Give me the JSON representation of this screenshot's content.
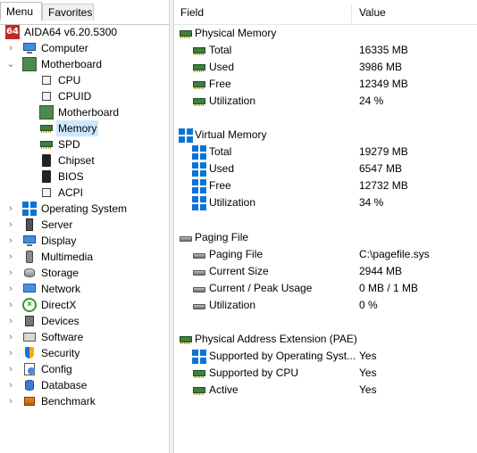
{
  "tabs": [
    {
      "label": "Menu",
      "active": true
    },
    {
      "label": "Favorites",
      "active": false
    }
  ],
  "tree": {
    "root": {
      "label": "AIDA64 v6.20.5300",
      "icon": "aida64-icon"
    },
    "items": [
      {
        "label": "Computer",
        "icon": "computer-icon",
        "expanded": false
      },
      {
        "label": "Motherboard",
        "icon": "motherboard-icon",
        "expanded": true,
        "children": [
          {
            "label": "CPU",
            "icon": "cpu-icon"
          },
          {
            "label": "CPUID",
            "icon": "cpuid-icon"
          },
          {
            "label": "Motherboard",
            "icon": "motherboard-icon"
          },
          {
            "label": "Memory",
            "icon": "memory-icon",
            "selected": true
          },
          {
            "label": "SPD",
            "icon": "spd-icon"
          },
          {
            "label": "Chipset",
            "icon": "chipset-icon"
          },
          {
            "label": "BIOS",
            "icon": "bios-icon"
          },
          {
            "label": "ACPI",
            "icon": "acpi-icon"
          }
        ]
      },
      {
        "label": "Operating System",
        "icon": "windows-icon",
        "expanded": false
      },
      {
        "label": "Server",
        "icon": "server-icon",
        "expanded": false
      },
      {
        "label": "Display",
        "icon": "display-icon",
        "expanded": false
      },
      {
        "label": "Multimedia",
        "icon": "multimedia-icon",
        "expanded": false
      },
      {
        "label": "Storage",
        "icon": "storage-icon",
        "expanded": false
      },
      {
        "label": "Network",
        "icon": "network-icon",
        "expanded": false
      },
      {
        "label": "DirectX",
        "icon": "directx-icon",
        "expanded": false
      },
      {
        "label": "Devices",
        "icon": "devices-icon",
        "expanded": false
      },
      {
        "label": "Software",
        "icon": "software-icon",
        "expanded": false
      },
      {
        "label": "Security",
        "icon": "security-icon",
        "expanded": false
      },
      {
        "label": "Config",
        "icon": "config-icon",
        "expanded": false
      },
      {
        "label": "Database",
        "icon": "database-icon",
        "expanded": false
      },
      {
        "label": "Benchmark",
        "icon": "benchmark-icon",
        "expanded": false
      }
    ]
  },
  "table": {
    "columns": {
      "field": "Field",
      "value": "Value"
    },
    "sections": [
      {
        "title": "Physical Memory",
        "icon": "ram-icon",
        "rows": [
          {
            "field": "Total",
            "value": "16335 MB",
            "icon": "ram-icon"
          },
          {
            "field": "Used",
            "value": "3986 MB",
            "icon": "ram-icon"
          },
          {
            "field": "Free",
            "value": "12349 MB",
            "icon": "ram-icon"
          },
          {
            "field": "Utilization",
            "value": "24 %",
            "icon": "ram-icon"
          }
        ]
      },
      {
        "title": "Virtual Memory",
        "icon": "windows-icon",
        "rows": [
          {
            "field": "Total",
            "value": "19279 MB",
            "icon": "windows-icon"
          },
          {
            "field": "Used",
            "value": "6547 MB",
            "icon": "windows-icon"
          },
          {
            "field": "Free",
            "value": "12732 MB",
            "icon": "windows-icon"
          },
          {
            "field": "Utilization",
            "value": "34 %",
            "icon": "windows-icon"
          }
        ]
      },
      {
        "title": "Paging File",
        "icon": "disk-icon",
        "rows": [
          {
            "field": "Paging File",
            "value": "C:\\pagefile.sys",
            "icon": "disk-icon"
          },
          {
            "field": "Current Size",
            "value": "2944 MB",
            "icon": "disk-icon"
          },
          {
            "field": "Current / Peak Usage",
            "value": "0 MB / 1 MB",
            "icon": "disk-icon"
          },
          {
            "field": "Utilization",
            "value": "0 %",
            "icon": "disk-icon"
          }
        ]
      },
      {
        "title": "Physical Address Extension (PAE)",
        "icon": "ram-icon",
        "rows": [
          {
            "field": "Supported by Operating Syst...",
            "value": "Yes",
            "icon": "windows-icon"
          },
          {
            "field": "Supported by CPU",
            "value": "Yes",
            "icon": "ram-icon"
          },
          {
            "field": "Active",
            "value": "Yes",
            "icon": "ram-icon"
          }
        ]
      }
    ]
  },
  "colors": {
    "selection": "#cce8ff",
    "accent": "#0a74d6",
    "aida_red": "#c62828"
  }
}
